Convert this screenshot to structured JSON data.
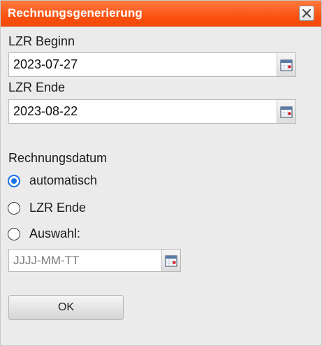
{
  "dialog": {
    "title": "Rechnungsgenerierung",
    "close_icon": "close-icon"
  },
  "lzr_begin": {
    "label": "LZR Beginn",
    "value": "2023-07-27",
    "calendar_icon": "calendar-icon"
  },
  "lzr_end": {
    "label": "LZR Ende",
    "value": "2023-08-22",
    "calendar_icon": "calendar-icon"
  },
  "invoice_date": {
    "label": "Rechnungsdatum",
    "options": [
      {
        "label": "automatisch",
        "checked": true
      },
      {
        "label": "LZR Ende",
        "checked": false
      },
      {
        "label": "Auswahl:",
        "checked": false
      }
    ],
    "date_placeholder": "JJJJ-MM-TT"
  },
  "ok_label": "OK",
  "colors": {
    "titlebar": "#fa4e0d",
    "radio_selected": "#1a73e8"
  }
}
